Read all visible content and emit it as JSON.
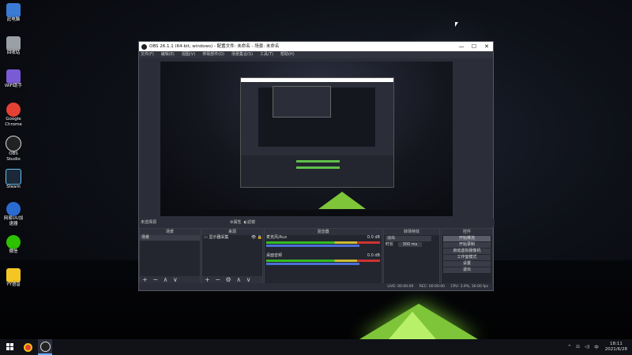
{
  "desktop": {
    "icons": [
      {
        "label": "此电脑",
        "icon": "computer-icon",
        "color": "#3a7bd5"
      },
      {
        "label": "回收站",
        "icon": "recycle-bin-icon",
        "color": "#9aa0a6"
      },
      {
        "label": "WiFi助手",
        "icon": "wifi-assistant-icon",
        "color": "#7a5bd6"
      },
      {
        "label": "Google Chrome",
        "icon": "chrome-icon",
        "color": "#e34133"
      },
      {
        "label": "OBS Studio",
        "icon": "obs-icon",
        "color": "#222222"
      },
      {
        "label": "Steam",
        "icon": "steam-icon",
        "color": "#1b2838"
      },
      {
        "label": "网易UU加速器",
        "icon": "uu-accelerator-icon",
        "color": "#2a6bd1"
      },
      {
        "label": "微信",
        "icon": "wechat-icon",
        "color": "#2dc100"
      },
      {
        "label": "YY语音",
        "icon": "yy-icon",
        "color": "#f3c623"
      }
    ]
  },
  "window": {
    "title": "OBS 26.1.1 (64-bit, windows) - 配置文件: 未命名 - 场景: 未命名",
    "controls": [
      "—",
      "☐",
      "✕"
    ],
    "menu": [
      "文件(F)",
      "编辑(E)",
      "视图(V)",
      "停靠部件(D)",
      "场景集合(S)",
      "工具(T)",
      "帮助(H)"
    ],
    "scene_header": "未选择源",
    "props_buttons": [
      "属性",
      "滤镜"
    ],
    "docks": {
      "scenes": {
        "title": "场景",
        "items": [
          "场景"
        ]
      },
      "sources": {
        "title": "来源",
        "items": [
          "显示器采集"
        ]
      },
      "mixer": {
        "title": "混音器",
        "channels": [
          {
            "name": "麦克风/Aux",
            "db": "0.0 dB"
          },
          {
            "name": "桌面音频",
            "db": "0.0 dB"
          }
        ]
      },
      "transitions": {
        "title": "转场特效",
        "type": "淡出",
        "duration_label": "时长",
        "duration": "300 ms"
      },
      "controls": {
        "title": "控件",
        "buttons": [
          "开始推流",
          "开始录制",
          "启动虚拟摄像机",
          "工作室模式",
          "设置",
          "退出"
        ]
      }
    },
    "status": [
      "LIVE: 00:00:00",
      "REC: 00:00:00",
      "CPU: 3.9%, 30.00 fps"
    ]
  },
  "taskbar": {
    "tray_icons": [
      "^",
      "⊡",
      "◁)",
      "中"
    ],
    "time": "18:11",
    "date": "2021/6/28"
  }
}
